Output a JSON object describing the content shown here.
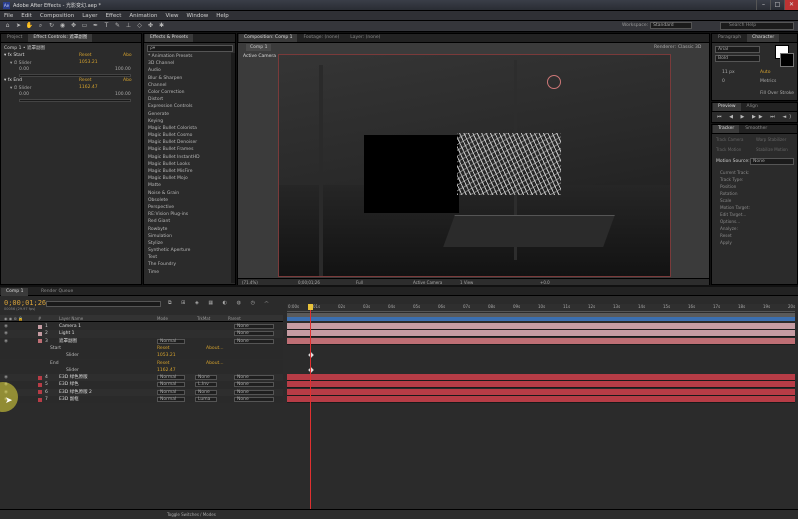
{
  "window": {
    "title": "Adobe After Effects - 光影变幻.aep *",
    "minimize": "–",
    "maximize": "□",
    "close": "✕"
  },
  "menu": [
    "File",
    "Edit",
    "Composition",
    "Layer",
    "Effect",
    "Animation",
    "View",
    "Window",
    "Help"
  ],
  "workspace": {
    "label": "Workspace:",
    "value": "Standard",
    "search_placeholder": "Search Help"
  },
  "project_panel": {
    "tabs": [
      "Project",
      "Effect Controls: 遮罩副图"
    ],
    "header": "Comp 1 • 遮罩副图",
    "effects": [
      {
        "name": "Start",
        "reset": "Reset",
        "about": "Abo",
        "param": "Slider",
        "value": "1053.21",
        "min": "0.00",
        "max": "100.00"
      },
      {
        "name": "End",
        "reset": "Reset",
        "about": "Abo",
        "param": "Slider",
        "value": "1162.47",
        "min": "0.00",
        "max": "100.00"
      }
    ]
  },
  "effects_panel": {
    "tab": "Effects & Presets",
    "search": "ρ▾",
    "items": [
      "* Animation Presets",
      "3D Channel",
      "Audio",
      "Blur & Sharpen",
      "Channel",
      "Color Correction",
      "Distort",
      "Expression Controls",
      "Generate",
      "Keying",
      "Magic Bullet Colorista",
      "Magic Bullet Cosmo",
      "Magic Bullet Denoiser",
      "Magic Bullet Frames",
      "Magic Bullet InstantHD",
      "Magic Bullet Looks",
      "Magic Bullet MisFire",
      "Magic Bullet Mojo",
      "Matte",
      "Noise & Grain",
      "Obsolete",
      "Perspective",
      "RE:Vision Plug-ins",
      "Red Giant",
      "Rowbyte",
      "Simulation",
      "Stylize",
      "Synthetic Aperture",
      "Text",
      "The Foundry",
      "Time"
    ]
  },
  "comp_viewer": {
    "tabs": [
      "Composition: Comp 1",
      "Footage: (none)",
      "Layer: (none)"
    ],
    "comp_tab": "Comp 1",
    "renderer": "Renderer:",
    "renderer_value": "Classic 3D",
    "view_label": "Active Camera",
    "footer": {
      "zoom": "(71.4%)",
      "time": "0;00;01;26",
      "res": "Full",
      "camera": "Active Camera",
      "views": "1 View",
      "exposure": "+0.0"
    }
  },
  "info_panel": {
    "tabs": [
      "Paragraph",
      "Character"
    ],
    "font": "Arial",
    "style": "Bold",
    "size": "11 px",
    "auto": "Auto",
    "tracking": "0",
    "metrics": "Metrics",
    "fill": "Fill Over Stroke"
  },
  "preview_panel": {
    "tabs": [
      "Preview",
      "Align"
    ]
  },
  "tracker_panel": {
    "tabs": [
      "Tracker",
      "Smoother"
    ],
    "buttons": [
      "Track Camera",
      "Warp Stabilizer",
      "Track Motion",
      "Stabilize Motion"
    ],
    "motion_source_label": "Motion Source:",
    "motion_source": "None",
    "rows": [
      "Current Track:",
      "Track Type:",
      "Position",
      "Rotation",
      "Scale",
      "Motion Target:",
      "Edit Target...",
      "Options...",
      "Analyze:",
      "Reset",
      "Apply"
    ]
  },
  "timeline": {
    "tabs": [
      "Comp 1",
      "Render Queue"
    ],
    "timecode": "0;00;01;26",
    "fps": "00056 (29.97 fps)",
    "columns": {
      "num": "#",
      "name": "Layer Name",
      "mode": "Mode",
      "trkmat": "TrkMat",
      "parent": "Parent"
    },
    "layers": [
      {
        "num": "1",
        "name": "Camera 1",
        "color": "#c69ca3",
        "mode": "",
        "trk": "",
        "parent": "None"
      },
      {
        "num": "2",
        "name": "Light 1",
        "color": "#c69ca3",
        "mode": "",
        "trk": "",
        "parent": "None"
      },
      {
        "num": "3",
        "name": "遮罩副图",
        "color": "#bf6f75",
        "mode": "Normal",
        "trk": "",
        "parent": "None"
      },
      {
        "num": "4",
        "name": "E3D 绿色原版",
        "color": "#b73c46",
        "mode": "Normal",
        "trk": "None",
        "parent": "None"
      },
      {
        "num": "5",
        "name": "E3D 绿色",
        "color": "#b73c46",
        "mode": "Normal",
        "trk": "L.Inv",
        "parent": "None"
      },
      {
        "num": "6",
        "name": "E3D 绿色原版 2",
        "color": "#b73c46",
        "mode": "Normal",
        "trk": "None",
        "parent": "None"
      },
      {
        "num": "7",
        "name": "E3D 副框",
        "color": "#b73c46",
        "mode": "Normal",
        "trk": "Luma",
        "parent": "None"
      }
    ],
    "sub": {
      "start": "Start",
      "end": "End",
      "slider": "Slider",
      "reset": "Reset",
      "about": "About...",
      "start_value": "1053.21",
      "end_value": "1162.47"
    },
    "ruler": [
      "0:00s",
      "01s",
      "02s",
      "03s",
      "04s",
      "05s",
      "06s",
      "07s",
      "08s",
      "09s",
      "10s",
      "11s",
      "12s",
      "13s",
      "14s",
      "15s",
      "16s",
      "17s",
      "18s",
      "19s",
      "20s"
    ],
    "footer": "Toggle Switches / Modes"
  }
}
